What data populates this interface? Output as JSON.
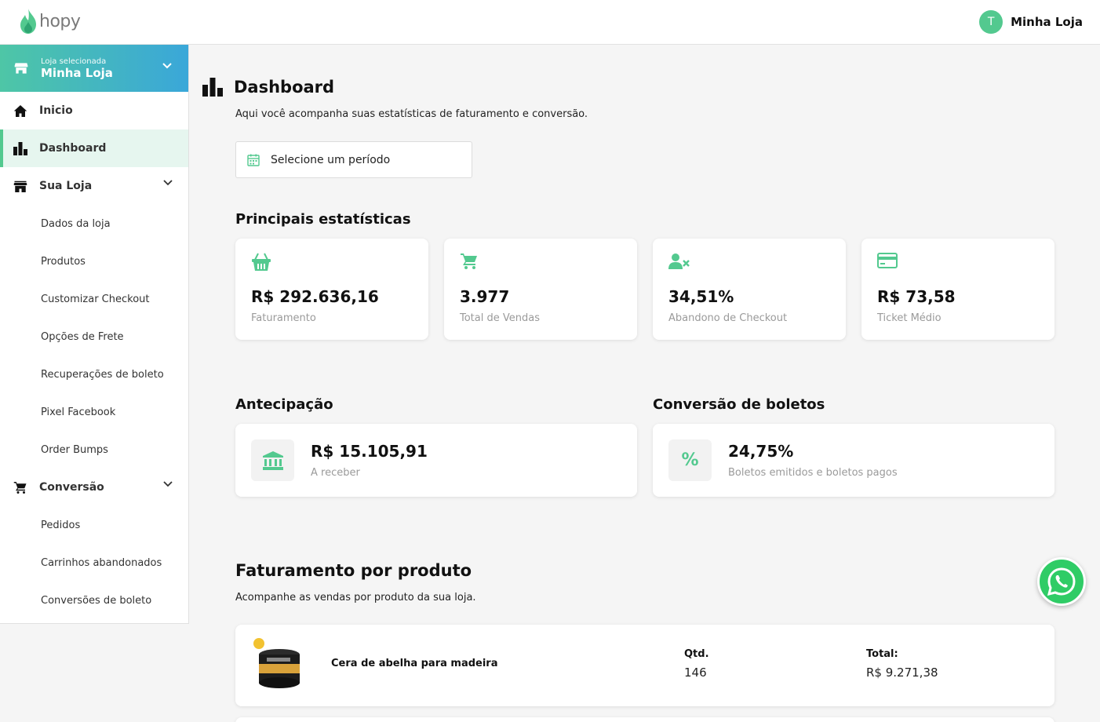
{
  "brand": {
    "name": "hopy",
    "accent": "#53c98f"
  },
  "user": {
    "initial": "T",
    "name": "Minha Loja"
  },
  "store_selector": {
    "label": "Loja selecionada",
    "name": "Minha Loja"
  },
  "sidebar": {
    "items": [
      {
        "label": "Inicio",
        "icon": "home-icon"
      },
      {
        "label": "Dashboard",
        "icon": "bar-chart-icon",
        "active": true
      },
      {
        "label": "Sua Loja",
        "icon": "store-icon",
        "expanded": true,
        "children": [
          "Dados da loja",
          "Produtos",
          "Customizar Checkout",
          "Opções de Frete",
          "Recuperações de boleto",
          "Pixel Facebook",
          "Order Bumps"
        ]
      },
      {
        "label": "Conversão",
        "icon": "cart-icon",
        "expanded": true,
        "children": [
          "Pedidos",
          "Carrinhos abandonados",
          "Conversões de boleto"
        ]
      }
    ]
  },
  "page": {
    "title": "Dashboard",
    "subtitle": "Aqui você acompanha suas estatísticas de faturamento e conversão.",
    "period_placeholder": "Selecione um período"
  },
  "stats": {
    "title": "Principais estatísticas",
    "cards": [
      {
        "value": "R$ 292.636,16",
        "label": "Faturamento",
        "icon": "basket-icon"
      },
      {
        "value": "3.977",
        "label": "Total de Vendas",
        "icon": "cart-icon"
      },
      {
        "value": "34,51%",
        "label": "Abandono de Checkout",
        "icon": "user-remove-icon"
      },
      {
        "value": "R$ 73,58",
        "label": "Ticket Médio",
        "icon": "credit-card-icon"
      }
    ]
  },
  "antecipacao": {
    "title": "Antecipação",
    "value": "R$ 15.105,91",
    "label": "A receber",
    "icon": "bank-icon"
  },
  "boletos": {
    "title": "Conversão de boletos",
    "value": "24,75%",
    "label": "Boletos emitidos e boletos pagos",
    "icon": "percent-icon",
    "glyph": "%"
  },
  "products": {
    "title": "Faturamento por produto",
    "subtitle": "Acompanhe as vendas por produto da sua loja.",
    "qty_header": "Qtd.",
    "total_header": "Total:",
    "rows": [
      {
        "name": "Cera de abelha para madeira",
        "qty": "146",
        "total": "R$ 9.271,38"
      }
    ]
  }
}
